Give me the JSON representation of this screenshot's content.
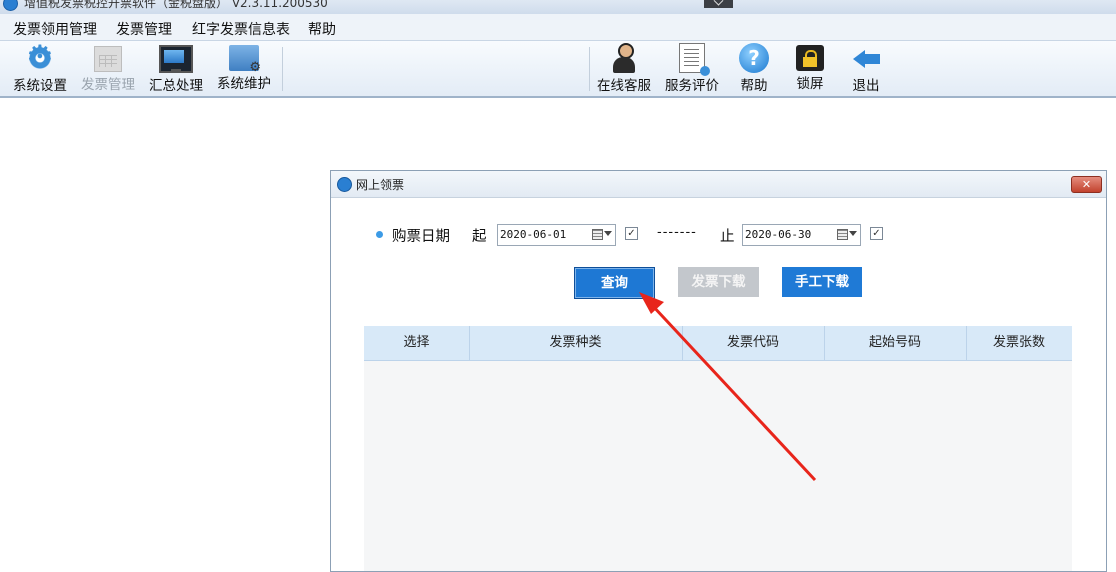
{
  "window": {
    "title": "增值税发票税控开票软件（金税盘版） V2.3.11.200530"
  },
  "menubar": {
    "items": [
      "发票领用管理",
      "发票管理",
      "红字发票信息表",
      "帮助"
    ]
  },
  "toolbar": {
    "left": [
      {
        "label": "系统设置",
        "icon": "gear-icon",
        "enabled": true
      },
      {
        "label": "发票管理",
        "icon": "invoice-grid-icon",
        "enabled": false
      },
      {
        "label": "汇总处理",
        "icon": "monitor-icon",
        "enabled": true
      },
      {
        "label": "系统维护",
        "icon": "folder-gear-icon",
        "enabled": true
      }
    ],
    "right": [
      {
        "label": "在线客服",
        "icon": "person-icon"
      },
      {
        "label": "服务评价",
        "icon": "clipboard-icon"
      },
      {
        "label": "帮助",
        "icon": "help-icon"
      },
      {
        "label": "锁屏",
        "icon": "lock-icon"
      },
      {
        "label": "退出",
        "icon": "exit-arrow-icon"
      }
    ]
  },
  "dialog": {
    "title": "网上领票",
    "close_glyph": "✕",
    "date_filter": {
      "label": "购票日期",
      "start_label": "起",
      "start_value": "2020-06-01",
      "start_checked": true,
      "separator": "-------",
      "end_label": "止",
      "end_value": "2020-06-30",
      "end_checked": true
    },
    "buttons": {
      "query": "查询",
      "download": "发票下载",
      "manual_download": "手工下载"
    },
    "table": {
      "columns": [
        "选择",
        "发票种类",
        "发票代码",
        "起始号码",
        "发票张数"
      ],
      "rows": []
    }
  },
  "colors": {
    "primary_button": "#1e78d4",
    "disabled_button": "#c3c7cc",
    "table_header": "#d8e9f8",
    "annotation_arrow": "#e8251b"
  }
}
